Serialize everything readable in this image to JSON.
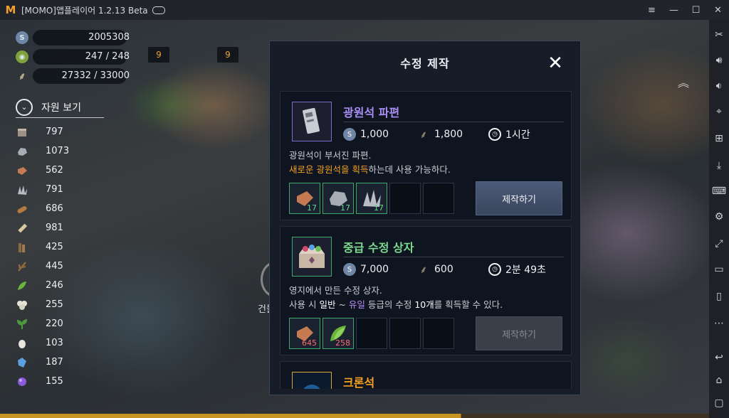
{
  "window": {
    "title": "[MOMO]앱플레이어 1.2.13 Beta",
    "logo_glyph": "M",
    "buttons": [
      "≡",
      "—",
      "☐",
      "✕"
    ]
  },
  "currencies": [
    {
      "icon": "silver-coin-icon",
      "value": "2005308",
      "color": "#6f86a6"
    },
    {
      "icon": "stamina-icon",
      "value": "247 / 248",
      "color": "#7ea33b"
    },
    {
      "icon": "grain-icon",
      "value": "27332 / 33000",
      "color": "#b8a88a"
    }
  ],
  "badges": [
    "9",
    "9"
  ],
  "resources": {
    "toggle_label": "자원 보기",
    "items": [
      {
        "icon": "stone-block-icon",
        "value": "797",
        "color": "#9b9184"
      },
      {
        "icon": "ore-icon",
        "value": "1073",
        "color": "#a7adb5"
      },
      {
        "icon": "brick-icon",
        "value": "562",
        "color": "#c57a52"
      },
      {
        "icon": "crystal-cluster-icon",
        "value": "791",
        "color": "#b9bec6"
      },
      {
        "icon": "log-icon",
        "value": "686",
        "color": "#b57a3e"
      },
      {
        "icon": "plank-icon",
        "value": "981",
        "color": "#d9c9a0"
      },
      {
        "icon": "wood-pile-icon",
        "value": "425",
        "color": "#8a6a45"
      },
      {
        "icon": "branch-icon",
        "value": "445",
        "color": "#8c6a3c"
      },
      {
        "icon": "leaf-icon",
        "value": "246",
        "color": "#69b53b"
      },
      {
        "icon": "cotton-icon",
        "value": "255",
        "color": "#e5e2d6"
      },
      {
        "icon": "herb-icon",
        "value": "220",
        "color": "#4d9a3d"
      },
      {
        "icon": "egg-icon",
        "value": "103",
        "color": "#e9e6df"
      },
      {
        "icon": "blue-gem-icon",
        "value": "187",
        "color": "#5aa0e0"
      },
      {
        "icon": "purple-orb-icon",
        "value": "155",
        "color": "#8a5ad8"
      }
    ]
  },
  "game_partial_label": "건물",
  "dialog": {
    "title": "수정 제작",
    "close_glyph": "✕",
    "recipes": [
      {
        "name": "광원석 파편",
        "name_color": "#a98ef3",
        "icon": "light-stone-fragment-icon",
        "cost_silver": "1,000",
        "cost_grain": "1,800",
        "cost_time": "1시간",
        "desc_line1": "광원석이 부서진 파편.",
        "desc_line2_hl": "새로운 광원석을 획득",
        "desc_line2_rest": "하는데 사용 가능하다.",
        "materials": [
          {
            "icon": "brick-icon",
            "count": "17",
            "enough": true
          },
          {
            "icon": "ore-icon",
            "count": "17",
            "enough": true
          },
          {
            "icon": "crystal-cluster-icon",
            "count": "17",
            "enough": true
          }
        ],
        "button": "제작하기",
        "button_enabled": true
      },
      {
        "name": "중급 수정 상자",
        "name_color": "#7cd98e",
        "icon": "crystal-chest-icon",
        "cost_silver": "7,000",
        "cost_grain": "600",
        "cost_time": "2분 49초",
        "desc_line1": "영지에서 만든 수정 상자.",
        "desc_line2_a": "사용 시 ",
        "desc_line2_b": "일반",
        "desc_line2_c": " ~ ",
        "desc_line2_d": "유일",
        "desc_line2_e": " 등급의 수정 ",
        "desc_line2_f": "10개",
        "desc_line2_g": "를 획득할 수 있다.",
        "materials": [
          {
            "icon": "brick-icon",
            "count": "645",
            "enough": false
          },
          {
            "icon": "leaf-icon",
            "count": "258",
            "enough": false
          }
        ],
        "button": "제작하기",
        "button_enabled": false
      },
      {
        "name": "크론석",
        "name_color": "#f4a122",
        "icon": "chron-stone-icon"
      }
    ]
  },
  "toolbar_icons": [
    "scissors-icon",
    "volume-up-icon",
    "volume-down-icon",
    "location-icon",
    "add-window-icon",
    "apk-install-icon",
    "keyboard-icon",
    "settings-icon",
    "fullscreen-icon",
    "screen-icon",
    "shake-icon",
    "more-icon",
    "back-icon",
    "home-icon",
    "recent-apps-icon"
  ]
}
